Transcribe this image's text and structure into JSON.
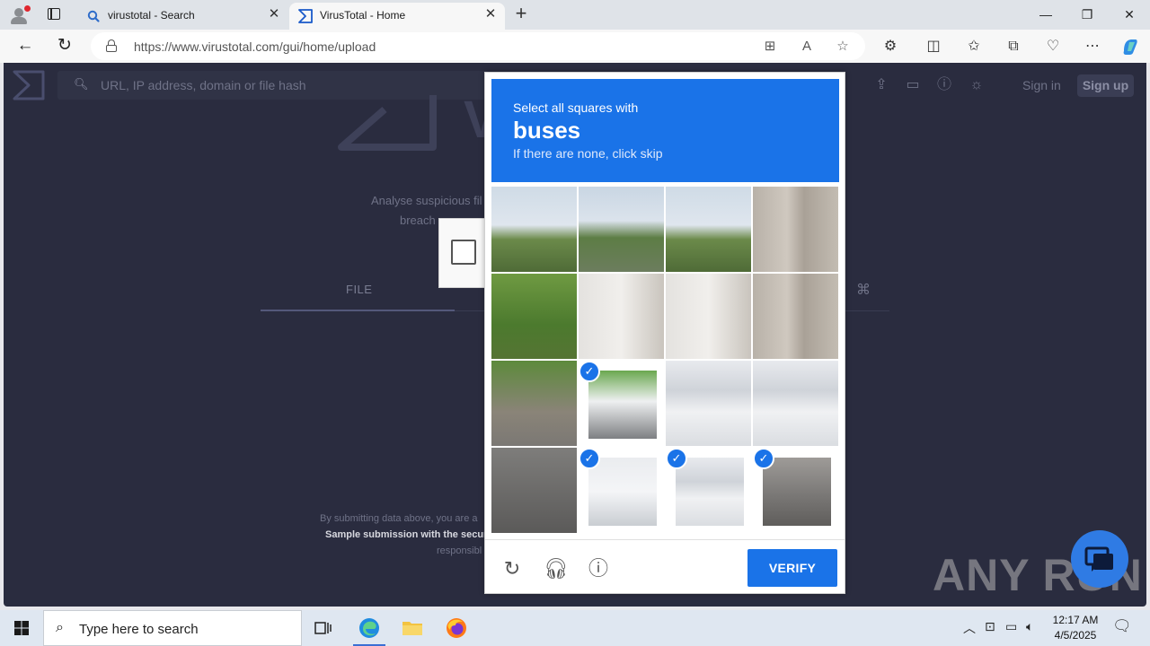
{
  "browser": {
    "tabs": [
      {
        "title": "virustotal - Search",
        "icon": "search-icon",
        "active": false
      },
      {
        "title": "VirusTotal - Home",
        "icon": "virustotal-logo-icon",
        "active": true
      }
    ],
    "url_host": "https://www.virustotal.com",
    "url_path": "/gui/home/upload"
  },
  "vt": {
    "search_placeholder": "URL, IP address, domain or file hash",
    "sign_in": "Sign in",
    "sign_up": "Sign up",
    "brand_fragment": "V",
    "desc_line1": "Analyse suspicious fil",
    "desc_line2": "breach",
    "tab_file": "FILE",
    "footer_line1": "By submitting data above, you are a",
    "footer_line2": "Sample submission with the secur",
    "footer_line3": "responsibl"
  },
  "captcha": {
    "instruction": "Select all squares with",
    "target": "buses",
    "hint": "If there are none, click skip",
    "verify_label": "VERIFY",
    "footer_icons": [
      "reload-icon",
      "audio-icon",
      "info-icon"
    ],
    "selected_tiles": [
      5,
      12,
      13,
      14
    ]
  },
  "watermark": "ANY RUN",
  "taskbar": {
    "search_placeholder": "Type here to search",
    "time": "12:17 AM",
    "date": "4/5/2025"
  },
  "colors": {
    "accent_blue": "#1a73e8",
    "vt_bg": "#2a2c3f"
  }
}
